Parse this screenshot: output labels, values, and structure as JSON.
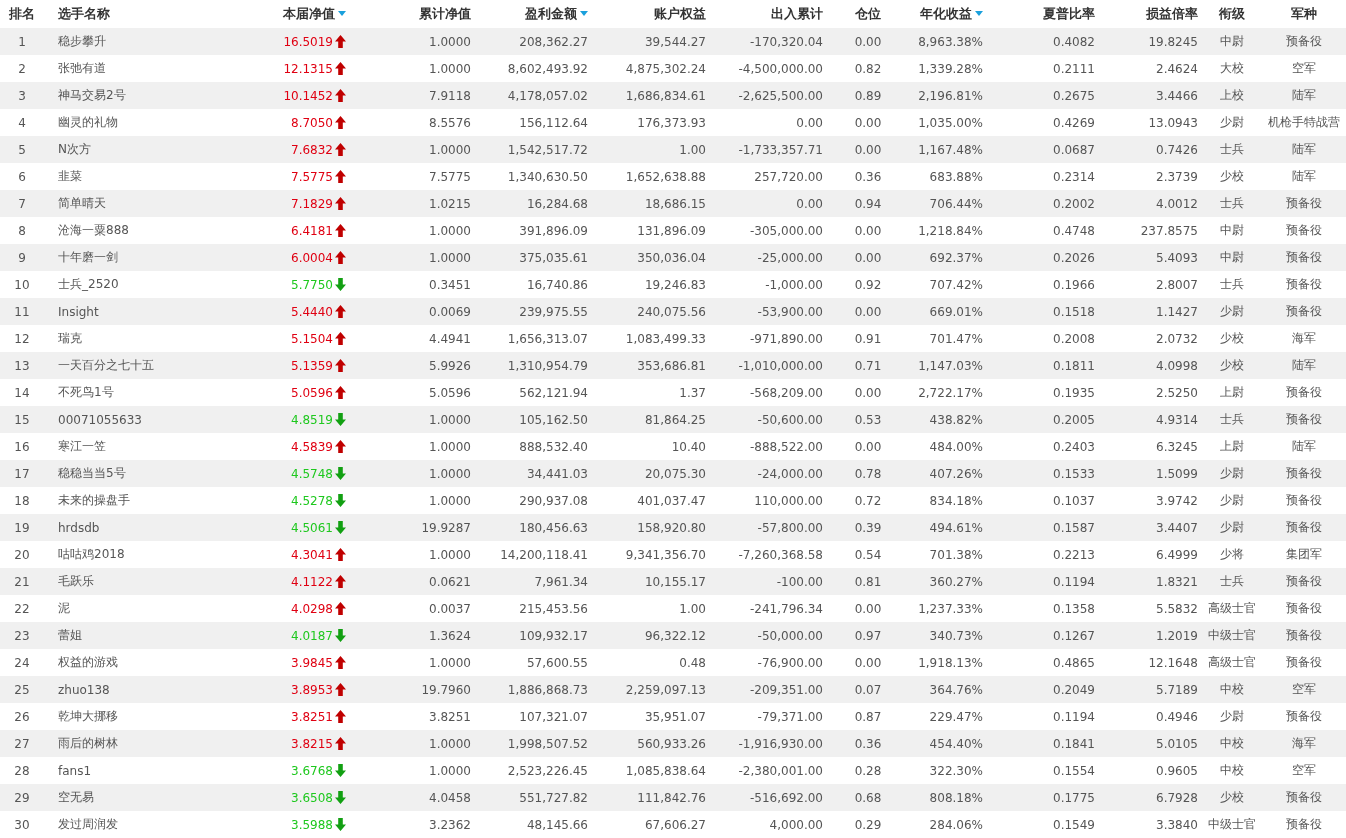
{
  "table": {
    "columns": [
      {
        "label": "排名",
        "sortable": false
      },
      {
        "label": "选手名称",
        "sortable": false
      },
      {
        "label": "本届净值",
        "sortable": true
      },
      {
        "label": "累计净值",
        "sortable": false
      },
      {
        "label": "盈利金额",
        "sortable": true
      },
      {
        "label": "账户权益",
        "sortable": false
      },
      {
        "label": "出入累计",
        "sortable": false
      },
      {
        "label": "仓位",
        "sortable": false
      },
      {
        "label": "年化收益",
        "sortable": true
      },
      {
        "label": "夏普比率",
        "sortable": false
      },
      {
        "label": "损益倍率",
        "sortable": false
      },
      {
        "label": "衔级",
        "sortable": false
      },
      {
        "label": "军种",
        "sortable": false
      }
    ],
    "rows": [
      {
        "cells": [
          "1",
          "稳步攀升",
          "16.5019",
          "1.0000",
          "208,362.27",
          "39,544.27",
          "-170,320.04",
          "0.00",
          "8,963.38%",
          "0.4082",
          "19.8245",
          "中尉",
          "预备役"
        ],
        "rising": true
      },
      {
        "cells": [
          "2",
          "张弛有道",
          "12.1315",
          "1.0000",
          "8,602,493.92",
          "4,875,302.24",
          "-4,500,000.00",
          "0.82",
          "1,339.28%",
          "0.2111",
          "2.4624",
          "大校",
          "空军"
        ],
        "rising": true
      },
      {
        "cells": [
          "3",
          "神马交易2号",
          "10.1452",
          "7.9118",
          "4,178,057.02",
          "1,686,834.61",
          "-2,625,500.00",
          "0.89",
          "2,196.81%",
          "0.2675",
          "3.4466",
          "上校",
          "陆军"
        ],
        "rising": true
      },
      {
        "cells": [
          "4",
          "幽灵的礼物",
          "8.7050",
          "8.5576",
          "156,112.64",
          "176,373.93",
          "0.00",
          "0.00",
          "1,035.00%",
          "0.4269",
          "13.0943",
          "少尉",
          "机枪手特战营"
        ],
        "rising": true
      },
      {
        "cells": [
          "5",
          "N次方",
          "7.6832",
          "1.0000",
          "1,542,517.72",
          "1.00",
          "-1,733,357.71",
          "0.00",
          "1,167.48%",
          "0.0687",
          "0.7426",
          "士兵",
          "陆军"
        ],
        "rising": true
      },
      {
        "cells": [
          "6",
          "韭菜",
          "7.5775",
          "7.5775",
          "1,340,630.50",
          "1,652,638.88",
          "257,720.00",
          "0.36",
          "683.88%",
          "0.2314",
          "2.3739",
          "少校",
          "陆军"
        ],
        "rising": true
      },
      {
        "cells": [
          "7",
          "简单晴天",
          "7.1829",
          "1.0215",
          "16,284.68",
          "18,686.15",
          "0.00",
          "0.94",
          "706.44%",
          "0.2002",
          "4.0012",
          "士兵",
          "预备役"
        ],
        "rising": true
      },
      {
        "cells": [
          "8",
          "沧海一粟888",
          "6.4181",
          "1.0000",
          "391,896.09",
          "131,896.09",
          "-305,000.00",
          "0.00",
          "1,218.84%",
          "0.4748",
          "237.8575",
          "中尉",
          "预备役"
        ],
        "rising": true
      },
      {
        "cells": [
          "9",
          "十年磨一剑",
          "6.0004",
          "1.0000",
          "375,035.61",
          "350,036.04",
          "-25,000.00",
          "0.00",
          "692.37%",
          "0.2026",
          "5.4093",
          "中尉",
          "预备役"
        ],
        "rising": true
      },
      {
        "cells": [
          "10",
          "士兵_2520",
          "5.7750",
          "0.3451",
          "16,740.86",
          "19,246.83",
          "-1,000.00",
          "0.92",
          "707.42%",
          "0.1966",
          "2.8007",
          "士兵",
          "预备役"
        ],
        "rising": false
      },
      {
        "cells": [
          "11",
          "Insight",
          "5.4440",
          "0.0069",
          "239,975.55",
          "240,075.56",
          "-53,900.00",
          "0.00",
          "669.01%",
          "0.1518",
          "1.1427",
          "少尉",
          "预备役"
        ],
        "rising": true
      },
      {
        "cells": [
          "12",
          "瑞克",
          "5.1504",
          "4.4941",
          "1,656,313.07",
          "1,083,499.33",
          "-971,890.00",
          "0.91",
          "701.47%",
          "0.2008",
          "2.0732",
          "少校",
          "海军"
        ],
        "rising": true
      },
      {
        "cells": [
          "13",
          "一天百分之七十五",
          "5.1359",
          "5.9926",
          "1,310,954.79",
          "353,686.81",
          "-1,010,000.00",
          "0.71",
          "1,147.03%",
          "0.1811",
          "4.0998",
          "少校",
          "陆军"
        ],
        "rising": true
      },
      {
        "cells": [
          "14",
          "不死鸟1号",
          "5.0596",
          "5.0596",
          "562,121.94",
          "1.37",
          "-568,209.00",
          "0.00",
          "2,722.17%",
          "0.1935",
          "2.5250",
          "上尉",
          "预备役"
        ],
        "rising": true
      },
      {
        "cells": [
          "15",
          "00071055633",
          "4.8519",
          "1.0000",
          "105,162.50",
          "81,864.25",
          "-50,600.00",
          "0.53",
          "438.82%",
          "0.2005",
          "4.9314",
          "士兵",
          "预备役"
        ],
        "rising": false
      },
      {
        "cells": [
          "16",
          "寒江一笠",
          "4.5839",
          "1.0000",
          "888,532.40",
          "10.40",
          "-888,522.00",
          "0.00",
          "484.00%",
          "0.2403",
          "6.3245",
          "上尉",
          "陆军"
        ],
        "rising": true
      },
      {
        "cells": [
          "17",
          "稳稳当当5号",
          "4.5748",
          "1.0000",
          "34,441.03",
          "20,075.30",
          "-24,000.00",
          "0.78",
          "407.26%",
          "0.1533",
          "1.5099",
          "少尉",
          "预备役"
        ],
        "rising": false
      },
      {
        "cells": [
          "18",
          "未来的操盘手",
          "4.5278",
          "1.0000",
          "290,937.08",
          "401,037.47",
          "110,000.00",
          "0.72",
          "834.18%",
          "0.1037",
          "3.9742",
          "少尉",
          "预备役"
        ],
        "rising": false
      },
      {
        "cells": [
          "19",
          "hrdsdb",
          "4.5061",
          "19.9287",
          "180,456.63",
          "158,920.80",
          "-57,800.00",
          "0.39",
          "494.61%",
          "0.1587",
          "3.4407",
          "少尉",
          "预备役"
        ],
        "rising": false
      },
      {
        "cells": [
          "20",
          "咕咕鸡2018",
          "4.3041",
          "1.0000",
          "14,200,118.41",
          "9,341,356.70",
          "-7,260,368.58",
          "0.54",
          "701.38%",
          "0.2213",
          "6.4999",
          "少将",
          "集团军"
        ],
        "rising": true
      },
      {
        "cells": [
          "21",
          "毛跃乐",
          "4.1122",
          "0.0621",
          "7,961.34",
          "10,155.17",
          "-100.00",
          "0.81",
          "360.27%",
          "0.1194",
          "1.8321",
          "士兵",
          "预备役"
        ],
        "rising": true
      },
      {
        "cells": [
          "22",
          "泥",
          "4.0298",
          "0.0037",
          "215,453.56",
          "1.00",
          "-241,796.34",
          "0.00",
          "1,237.33%",
          "0.1358",
          "5.5832",
          "高级士官",
          "预备役"
        ],
        "rising": true
      },
      {
        "cells": [
          "23",
          "蕾姐",
          "4.0187",
          "1.3624",
          "109,932.17",
          "96,322.12",
          "-50,000.00",
          "0.97",
          "340.73%",
          "0.1267",
          "1.2019",
          "中级士官",
          "预备役"
        ],
        "rising": false
      },
      {
        "cells": [
          "24",
          "权益的游戏",
          "3.9845",
          "1.0000",
          "57,600.55",
          "0.48",
          "-76,900.00",
          "0.00",
          "1,918.13%",
          "0.4865",
          "12.1648",
          "高级士官",
          "预备役"
        ],
        "rising": true
      },
      {
        "cells": [
          "25",
          "zhuo138",
          "3.8953",
          "19.7960",
          "1,886,868.73",
          "2,259,097.13",
          "-209,351.00",
          "0.07",
          "364.76%",
          "0.2049",
          "5.7189",
          "中校",
          "空军"
        ],
        "rising": true
      },
      {
        "cells": [
          "26",
          "乾坤大挪移",
          "3.8251",
          "3.8251",
          "107,321.07",
          "35,951.07",
          "-79,371.00",
          "0.87",
          "229.47%",
          "0.1194",
          "0.4946",
          "少尉",
          "预备役"
        ],
        "rising": true
      },
      {
        "cells": [
          "27",
          "雨后的树林",
          "3.8215",
          "1.0000",
          "1,998,507.52",
          "560,933.26",
          "-1,916,930.00",
          "0.36",
          "454.40%",
          "0.1841",
          "5.0105",
          "中校",
          "海军"
        ],
        "rising": true
      },
      {
        "cells": [
          "28",
          "fans1",
          "3.6768",
          "1.0000",
          "2,523,226.45",
          "1,085,838.64",
          "-2,380,001.00",
          "0.28",
          "322.30%",
          "0.1554",
          "0.9605",
          "中校",
          "空军"
        ],
        "rising": false
      },
      {
        "cells": [
          "29",
          "空无易",
          "3.6508",
          "4.0458",
          "551,727.82",
          "111,842.76",
          "-516,692.00",
          "0.68",
          "808.18%",
          "0.1775",
          "6.7928",
          "少校",
          "预备役"
        ],
        "rising": false
      },
      {
        "cells": [
          "30",
          "发过周润发",
          "3.5988",
          "3.2362",
          "48,145.66",
          "67,606.27",
          "4,000.00",
          "0.29",
          "284.06%",
          "0.1549",
          "3.3840",
          "中级士官",
          "预备役"
        ],
        "rising": false
      }
    ]
  }
}
